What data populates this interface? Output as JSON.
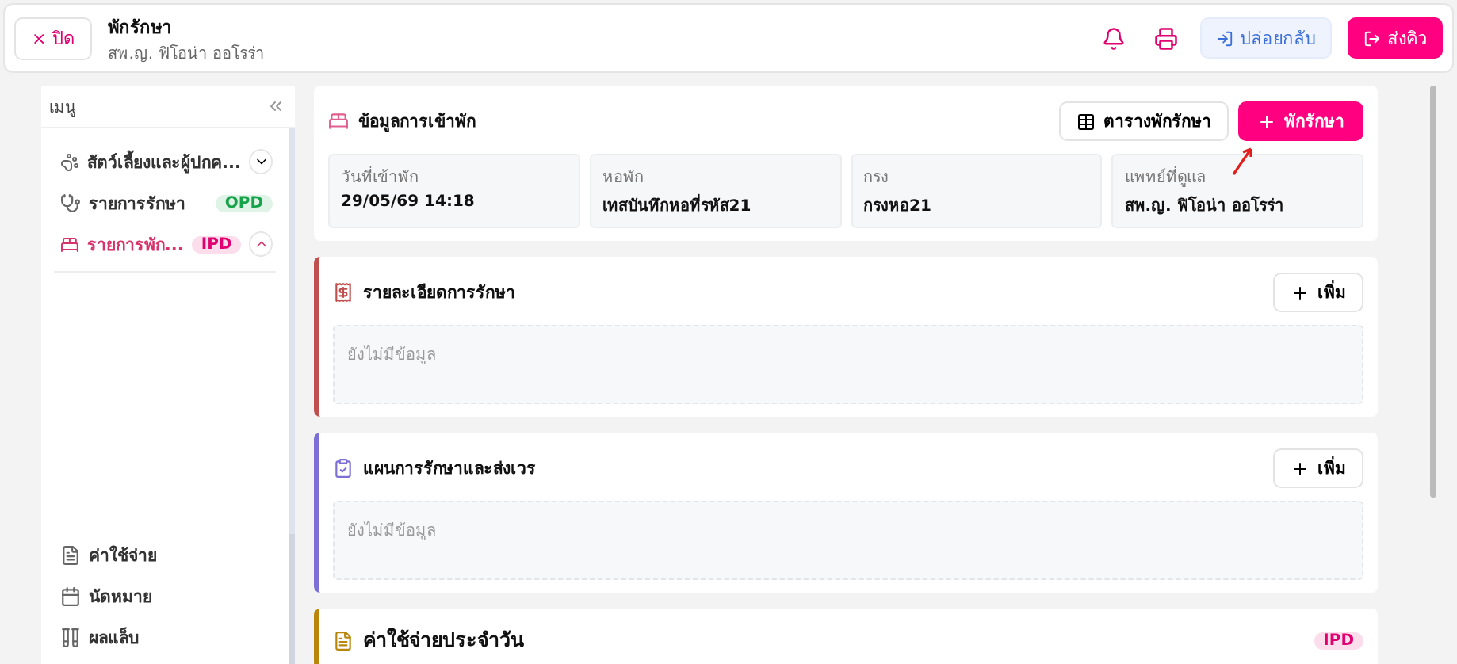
{
  "header": {
    "close_button": {
      "icon": "×",
      "label": "ปิด"
    },
    "title": "พักรักษา",
    "subtitle": "สพ.ญ. ฟิโอน่า ออโรร่า",
    "buttons": [
      {
        "kind": "secondary",
        "label": "ปล่อยกลับ"
      },
      {
        "kind": "primary",
        "label": "ส่งคิว"
      }
    ]
  },
  "sidebar": {
    "title": "เมนู",
    "items": [
      {
        "label": "สัตว์เลี้ยงและผู้ปกค...",
        "selected": false,
        "expanded": false
      },
      {
        "label": "รายการรักษา",
        "badge": "OPD",
        "color": "#16a34a",
        "selected": false
      },
      {
        "label": "รายการพัก...",
        "badge": "IPD",
        "color": "#e0006f",
        "selected": true,
        "expanded": true
      }
    ],
    "bottom_items": [
      {
        "label": "ค่าใช้จ่าย"
      },
      {
        "label": "นัดหมาย"
      },
      {
        "label": "ผลแล็บ"
      }
    ]
  },
  "admission": {
    "title": "ข้อมูลการเข้าพัก",
    "table_button": "ตารางพักรักษา",
    "admit_button": "พักรักษา",
    "fields": [
      {
        "label": "วันที่เข้าพัก",
        "value": "29/05/69 14:18"
      },
      {
        "label": "หอพัก",
        "value": "เทสบันทึกหอที่รหัส21"
      },
      {
        "label": "กรง",
        "value": "กรงหอ21"
      },
      {
        "label": "แพทย์ที่ดูแล",
        "value": "สพ.ญ. ฟิโอน่า ออโรร่า"
      }
    ]
  },
  "sections": [
    {
      "kind": "notes",
      "title": "รายละเอียดการรักษา",
      "color": "#c0504d",
      "add_button": "เพิ่ม",
      "empty_text": "ยังไม่มีข้อมูล"
    },
    {
      "kind": "plan",
      "title": "แผนการรักษาและส่งเวร",
      "color": "#7c6fd6",
      "add_button": "เพิ่ม",
      "empty_text": "ยังไม่มีข้อมูล"
    },
    {
      "kind": "cost",
      "title": "ค่าใช้จ่ายประจำวัน",
      "color": "#b8860b",
      "badge": "IPD"
    }
  ]
}
